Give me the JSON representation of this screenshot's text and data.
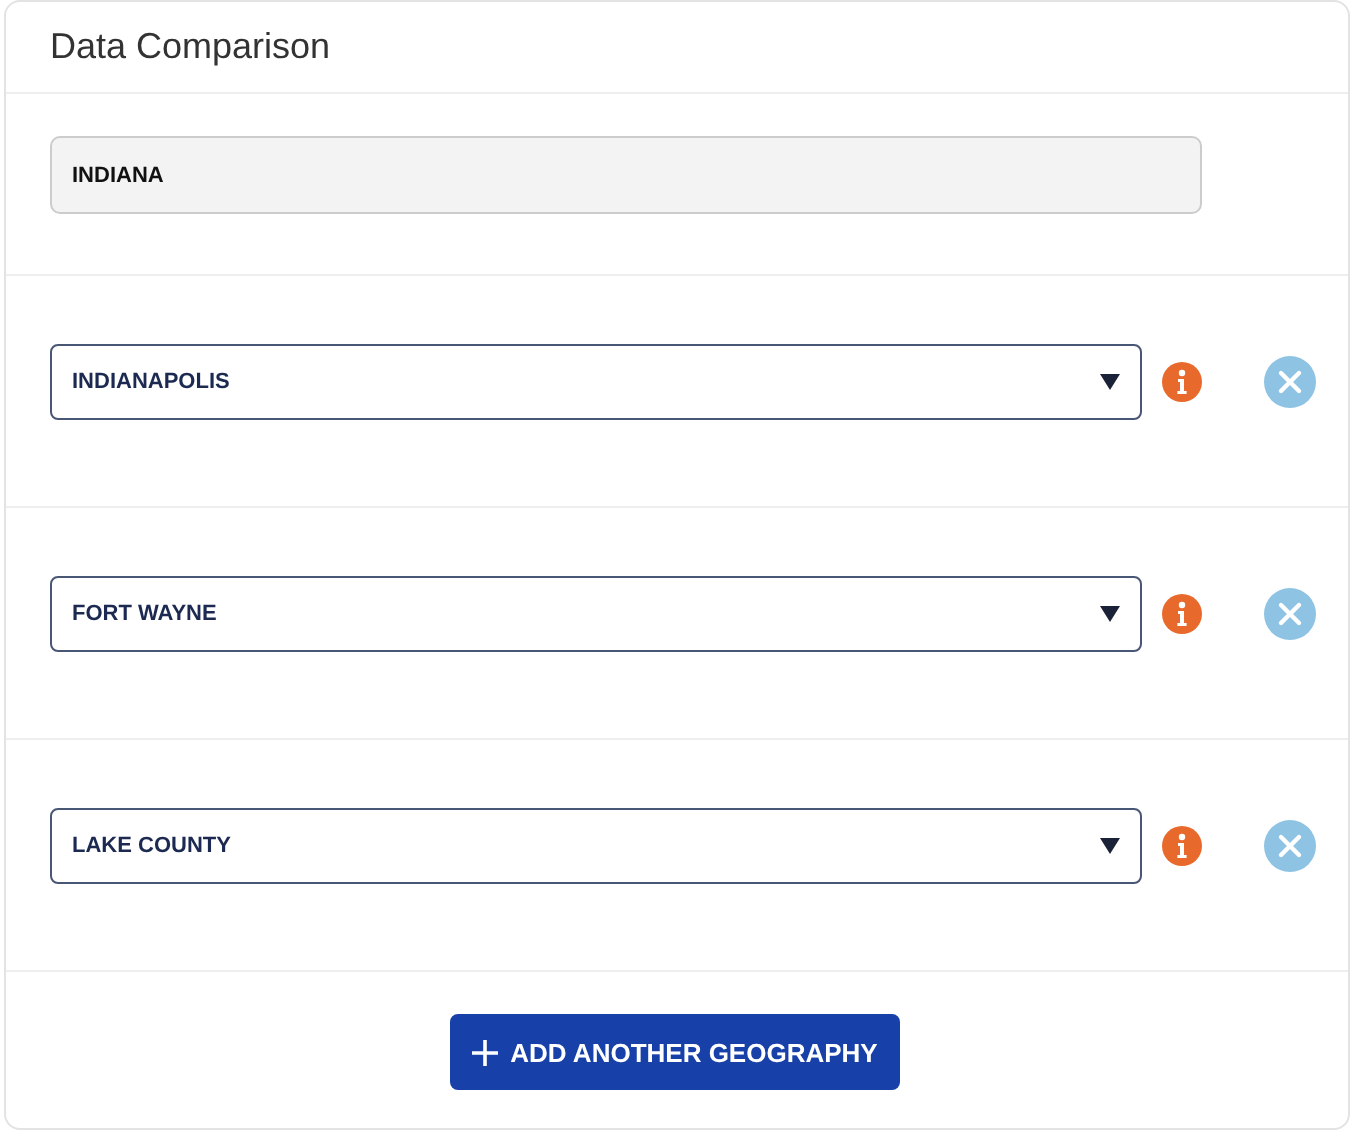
{
  "title": "Data Comparison",
  "state_field": {
    "value": "INDIANA",
    "disabled": true
  },
  "geographies": [
    {
      "value": "INDIANAPOLIS"
    },
    {
      "value": "FORT WAYNE"
    },
    {
      "value": "LAKE COUNTY"
    }
  ],
  "add_button": {
    "label": "ADD ANOTHER GEOGRAPHY"
  }
}
